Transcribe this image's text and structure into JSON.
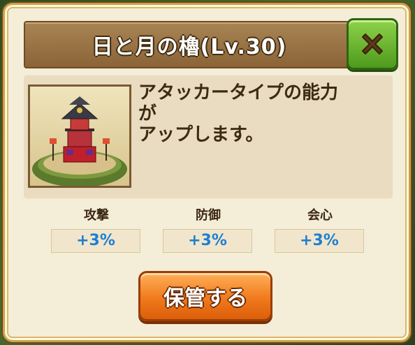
{
  "dialog": {
    "title": "日と月の櫓(Lv.30)",
    "close_icon": "close-x-icon",
    "description_lines": [
      "アタッカータイプの能力",
      "が",
      "アップします。"
    ],
    "image": "tower-building-image"
  },
  "stats": [
    {
      "label": "攻撃",
      "value": "+3%"
    },
    {
      "label": "防御",
      "value": "+3%"
    },
    {
      "label": "会心",
      "value": "+3%"
    }
  ],
  "store_button": {
    "label": "保管する"
  },
  "colors": {
    "title_bar": "#9a7444",
    "close_button": "#6cb832",
    "stat_value": "#1f7fd0",
    "store_button": "#f07a1c",
    "panel": "#f4edd8"
  }
}
